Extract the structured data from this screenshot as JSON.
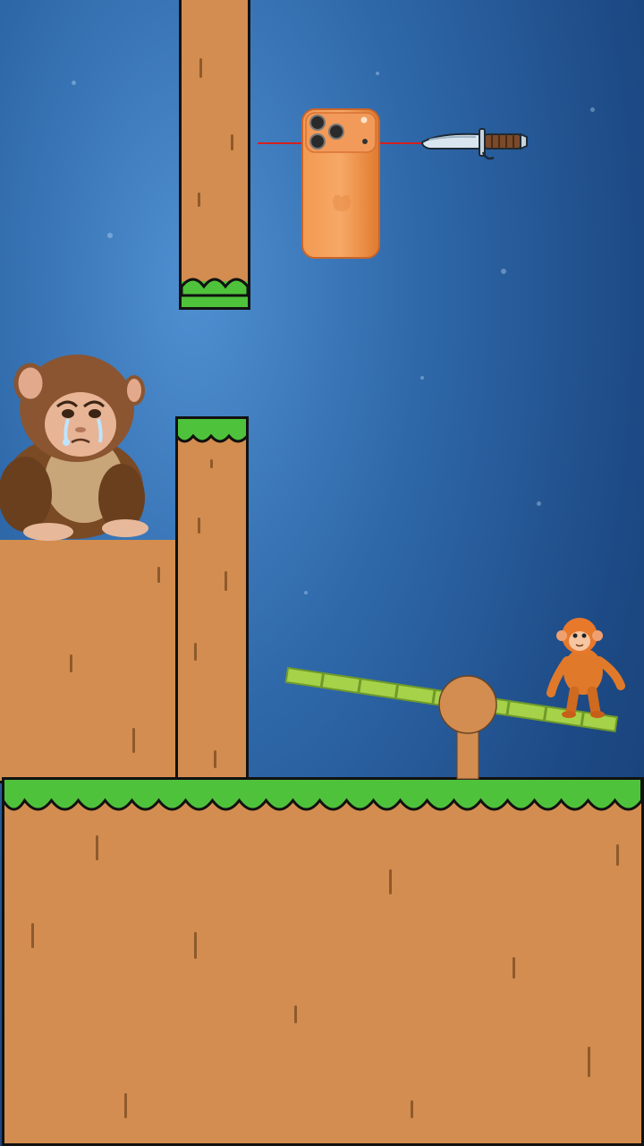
{
  "game": {
    "characters": [
      {
        "name": "sad-monkey",
        "mood": "crying"
      },
      {
        "name": "orange-monkey",
        "mood": "standing"
      }
    ],
    "objects": [
      "orange-phone",
      "knife",
      "cut-rope",
      "seesaw"
    ],
    "colors": {
      "sky": "#2f69aa",
      "dirt": "#d38d50",
      "grass": "#4fc23b",
      "bamboo": "#a6d24a",
      "rope": "#d61f1f",
      "phone": "#f08a3c"
    }
  }
}
